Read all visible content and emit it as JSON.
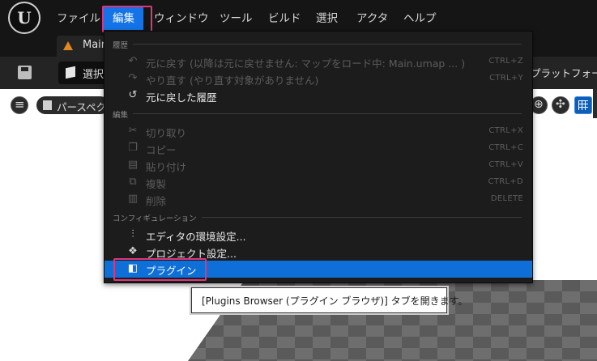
{
  "menubar": {
    "logo": "U",
    "items": [
      "ファイル",
      "編集",
      "ウィンドウ",
      "ツール",
      "ビルド",
      "選択",
      "アクタ",
      "ヘルプ"
    ]
  },
  "tab": {
    "label": "Main",
    "icon": "level-icon"
  },
  "toolbar": {
    "select_label": "選択",
    "platform_label": "プラットフォーム"
  },
  "viewport": {
    "view_mode": "パースペク"
  },
  "dropdown": {
    "sections": {
      "history": "履歴",
      "edit": "編集",
      "config": "コンフィギュレーション"
    },
    "items": [
      {
        "label": "元に戻す (以降は元に戻せません: マップをロード中: Main.umap ...   )",
        "shortcut": "CTRL+Z",
        "icon": "undo-icon",
        "enabled": false
      },
      {
        "label": "やり直す (やり直す対象がありません)",
        "shortcut": "CTRL+Y",
        "icon": "redo-icon",
        "enabled": false
      },
      {
        "label": "元に戻した履歴",
        "shortcut": "",
        "icon": "history-icon",
        "enabled": true
      },
      {
        "label": "切り取り",
        "shortcut": "CTRL+X",
        "icon": "cut-icon",
        "enabled": false
      },
      {
        "label": "コピー",
        "shortcut": "CTRL+C",
        "icon": "copy-icon",
        "enabled": false
      },
      {
        "label": "貼り付け",
        "shortcut": "CTRL+V",
        "icon": "paste-icon",
        "enabled": false
      },
      {
        "label": "複製",
        "shortcut": "CTRL+D",
        "icon": "duplicate-icon",
        "enabled": false
      },
      {
        "label": "削除",
        "shortcut": "DELETE",
        "icon": "delete-icon",
        "enabled": false
      },
      {
        "label": "エディタの環境設定...",
        "shortcut": "",
        "icon": "sliders-icon",
        "enabled": true
      },
      {
        "label": "プロジェクト設定...",
        "shortcut": "",
        "icon": "project-settings-icon",
        "enabled": true
      },
      {
        "label": "プラグイン",
        "shortcut": "",
        "icon": "plugin-icon",
        "enabled": true
      }
    ]
  },
  "tooltip": "[Plugins Browser (プラグイン ブラウザ)] タブを開きます。",
  "colors": {
    "accent": "#1473e6",
    "highlight_box": "#e0357a",
    "selected_row": "#0e6fd8"
  }
}
